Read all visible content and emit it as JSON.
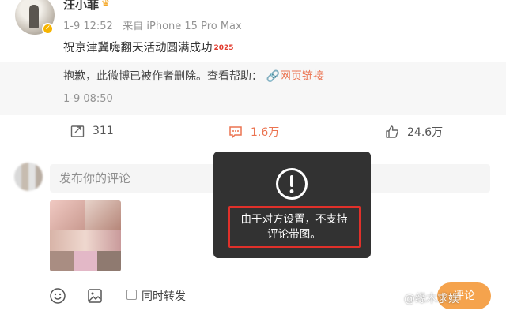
{
  "post": {
    "username": "汪小菲",
    "time": "1-9 12:52",
    "source": "来自 iPhone 15 Pro Max",
    "text": "祝京津冀嗨翻天活动圆满成功",
    "badge": "2025"
  },
  "quoted": {
    "deleted_notice": "抱歉，此微博已被作者删除。查看帮助：",
    "link_label": "网页链接",
    "time": "1-9 08:50"
  },
  "actions": {
    "repost_count": "311",
    "comment_count": "1.6万",
    "like_count": "24.6万"
  },
  "composer": {
    "placeholder": "发布你的评论",
    "repost_label": "同时转发",
    "send_label": "评论"
  },
  "toast": {
    "message_line1": "由于对方设置，不支持",
    "message_line2": "评论带图。"
  },
  "watermark": "@缘木求娱",
  "colors": {
    "accent": "#eb7350",
    "send_button": "#f5a34d",
    "highlight_border": "#e0302a"
  }
}
